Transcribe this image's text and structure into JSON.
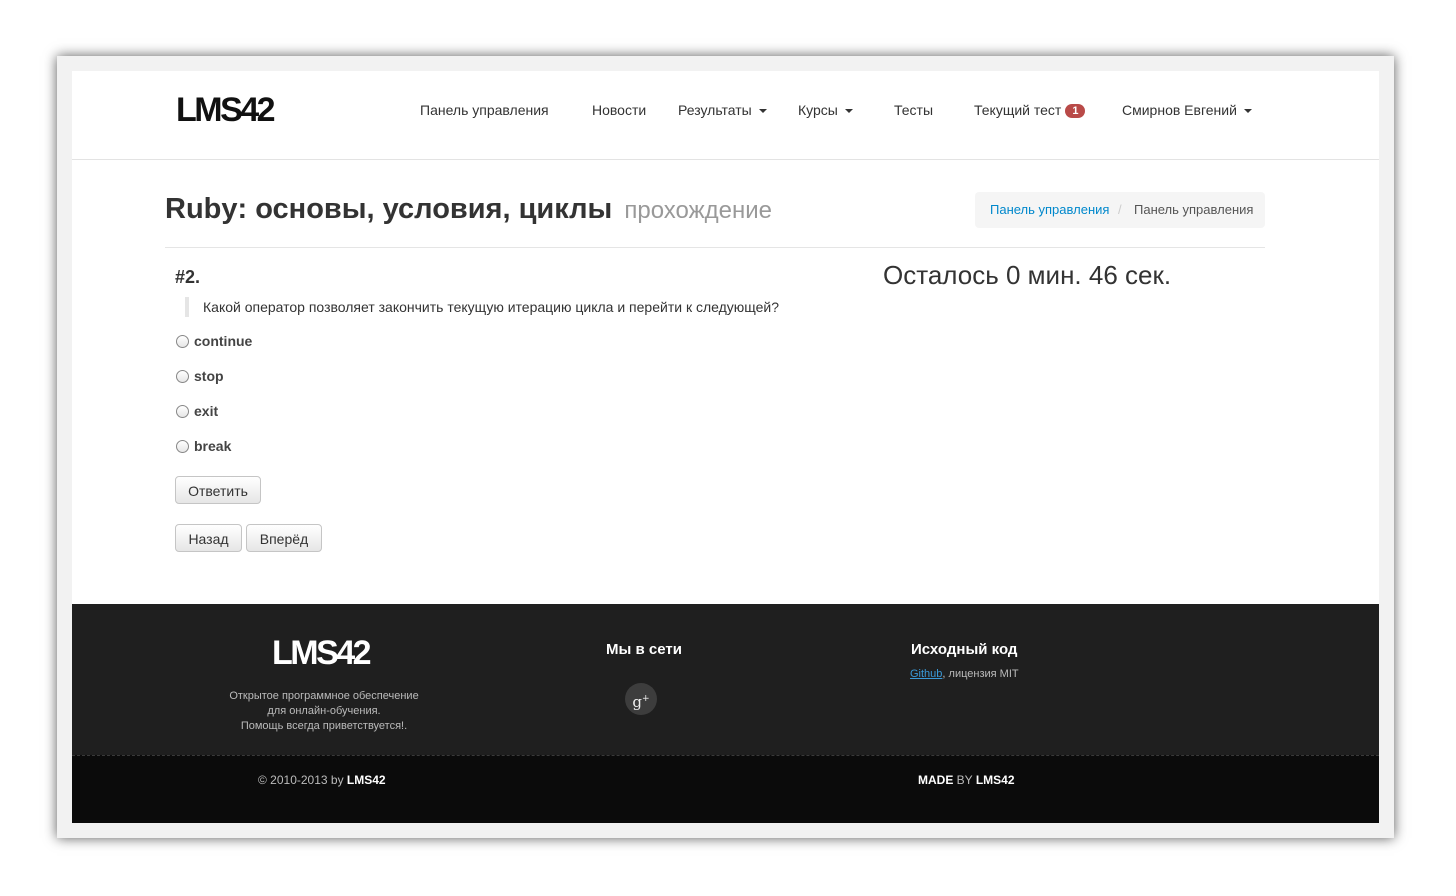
{
  "navbar": {
    "brand": "LMS42",
    "items": [
      {
        "label": "Панель управления"
      },
      {
        "label": "Новости"
      },
      {
        "label": "Результаты"
      },
      {
        "label": "Курсы"
      },
      {
        "label": "Тесты"
      },
      {
        "label": "Текущий тест",
        "badge": "1"
      },
      {
        "label": "Смирнов Евгений"
      }
    ]
  },
  "page": {
    "title": "Ruby: основы, условия, циклы",
    "subtitle": "прохождение"
  },
  "breadcrumb": {
    "link": "Панель управления",
    "separator": "/",
    "active": "Панель управления"
  },
  "question": {
    "number": "#2.",
    "text": "Какой оператор позволяет закончить текущую итерацию цикла и перейти к следующей?",
    "options": [
      "continue",
      "stop",
      "exit",
      "break"
    ],
    "selected": null
  },
  "timer": "Осталось 0 мин. 46 сек.",
  "buttons": {
    "answer": "Ответить",
    "back": "Назад",
    "forward": "Вперёд"
  },
  "footer": {
    "logo": "LMS42",
    "about": [
      "Открытое программное обеспечение",
      "для онлайн-обучения.",
      "Помощь всегда приветствуется!."
    ],
    "social_heading": "Мы в сети",
    "social_icon": "g",
    "social_icon_sup": "+",
    "source_heading": "Исходный код",
    "github_link": "Github",
    "license": ", лицензия MIT",
    "copyright_prefix": "© 2010-2013 by ",
    "copyright_brand": "LMS42",
    "made": "MADE",
    "by": " BY ",
    "made_brand": "LMS42"
  },
  "colors": {
    "link": "#0088cc",
    "badge": "#b94a48",
    "footer_bg": "#1e1e1e"
  }
}
